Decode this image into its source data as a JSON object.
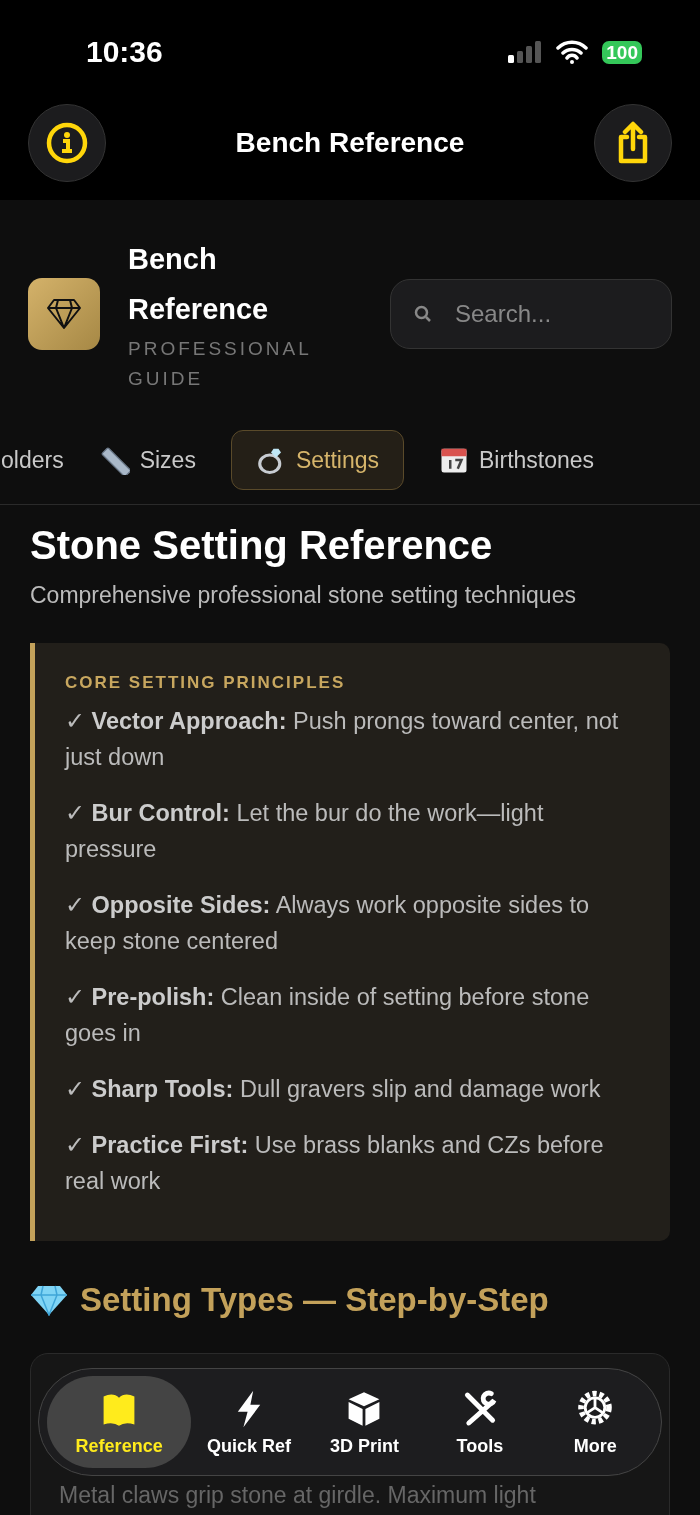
{
  "status_bar": {
    "time": "10:36",
    "battery": "100"
  },
  "nav_bar": {
    "title": "Bench Reference"
  },
  "brand": {
    "title": "Bench Reference",
    "subtitle": "PROFESSIONAL GUIDE"
  },
  "search": {
    "placeholder": "Search..."
  },
  "tabs": [
    {
      "label": "olders",
      "kind": "plain",
      "selected": false
    },
    {
      "label": "Sizes",
      "kind": "ruler",
      "selected": false
    },
    {
      "label": "Settings",
      "kind": "ring",
      "selected": true
    },
    {
      "label": "Birthstones",
      "kind": "calendar",
      "selected": false
    }
  ],
  "page": {
    "title": "Stone Setting Reference",
    "subtitle": "Comprehensive professional stone setting techniques"
  },
  "principles": {
    "heading": "CORE SETTING PRINCIPLES",
    "items": [
      {
        "text": "✓ **Vector Approach:** Push prongs toward center, not just down"
      },
      {
        "text": "✓ **Bur Control:** Let the bur do the work—light pressure"
      },
      {
        "text": "✓ **Opposite Sides:** Always work opposite sides to keep stone centered"
      },
      {
        "text": "✓ **Pre-polish:** Clean inside of setting before stone goes in"
      },
      {
        "text": "✓ **Sharp Tools:** Dull gravers slip and damage work"
      },
      {
        "text": "✓ **Practice First:** Use brass blanks and CZs before real work"
      }
    ]
  },
  "section": {
    "title": "Setting Types — Step-by-Step"
  },
  "card": {
    "text": "Metal claws grip stone at girdle. Maximum light"
  },
  "tab_bar": [
    {
      "label": "Reference",
      "kind": "book",
      "selected": true
    },
    {
      "label": "Quick Ref",
      "kind": "bolt",
      "selected": false
    },
    {
      "label": "3D Print",
      "kind": "cube",
      "selected": false
    },
    {
      "label": "Tools",
      "kind": "tools",
      "selected": false
    },
    {
      "label": "More",
      "kind": "gear",
      "selected": false
    }
  ]
}
